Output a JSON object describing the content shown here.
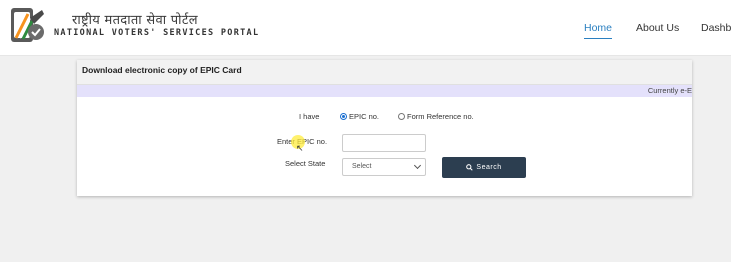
{
  "header": {
    "brand_hindi": "राष्ट्रीय मतदाता सेवा पोर्टल",
    "brand_english": "NATIONAL VOTERS' SERVICES PORTAL",
    "nav": {
      "home": "Home",
      "about": "About Us",
      "dashboard": "Dashbo"
    }
  },
  "card": {
    "title": "Download electronic copy of EPIC Card",
    "marquee": "Currently e-E",
    "i_have_label": "I have",
    "radio_options": {
      "epic": "EPIC no.",
      "form_ref": "Form Reference no."
    },
    "selected_option": "EPIC no.",
    "epic_label": "Enter EPIC no.",
    "epic_value": "",
    "state_label": "Select State",
    "state_selected": "Select",
    "search_label": "Search"
  },
  "colors": {
    "accent": "#2a7fc0",
    "button": "#2c3e50",
    "marquee_bg": "#e4e1fb",
    "flag_saffron": "#f7931e",
    "flag_green": "#2e8b3e"
  }
}
